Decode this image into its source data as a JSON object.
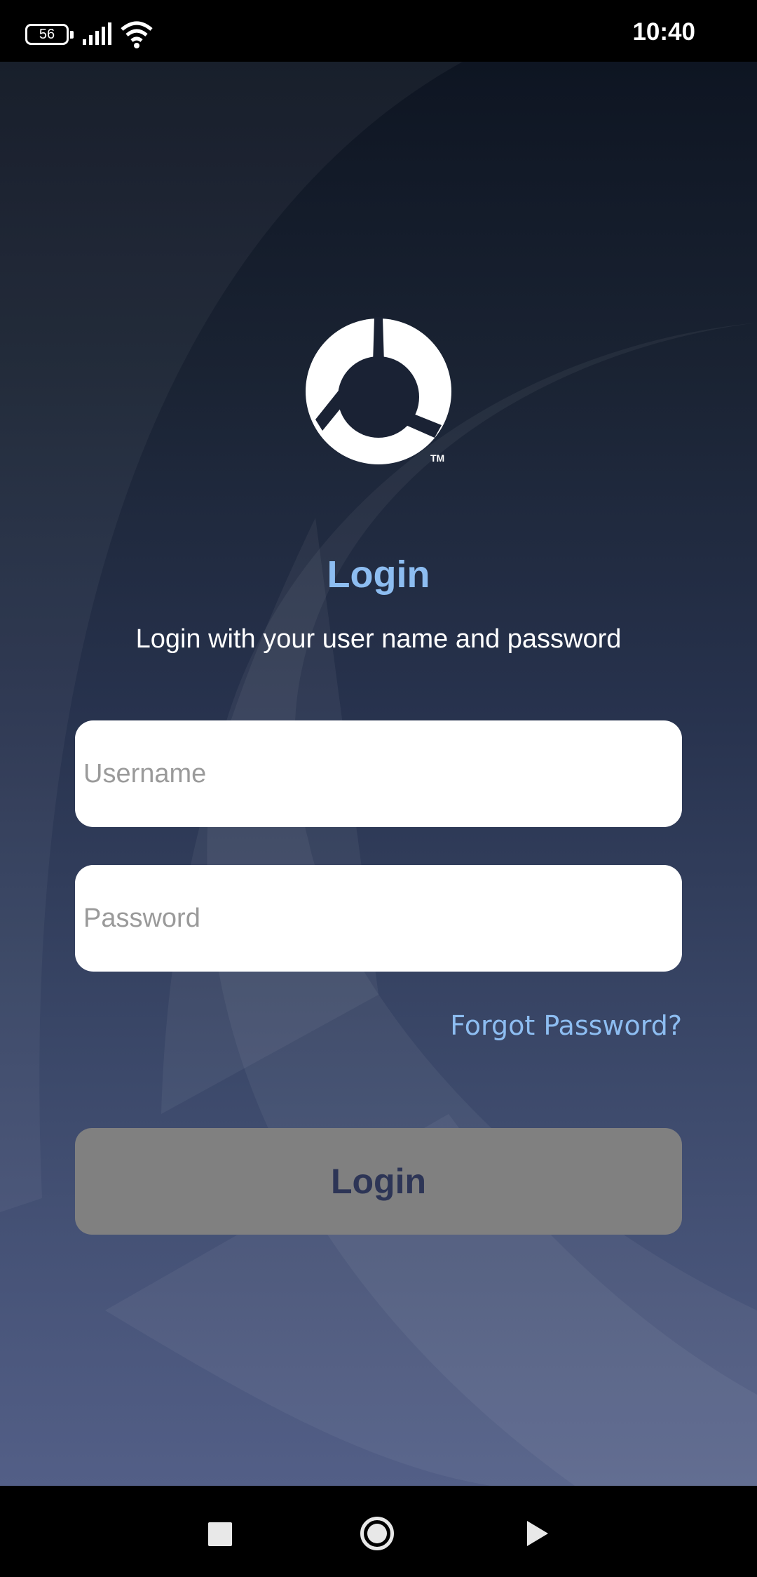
{
  "status_bar": {
    "battery_level": "56",
    "time": "10:40",
    "icons": [
      "battery-icon",
      "signal-icon",
      "wifi-icon"
    ]
  },
  "login": {
    "title": "Login",
    "subtitle": "Login with your user name and password",
    "username_placeholder": "Username",
    "password_placeholder": "Password",
    "forgot_password": "Forgot Password?",
    "button_label": "Login"
  },
  "logo": {
    "trademark": "TM"
  },
  "nav_bar": {
    "icons": [
      "recents-icon",
      "home-icon",
      "back-icon"
    ]
  },
  "colors": {
    "accent": "#8dbdf1",
    "button_disabled": "#808080",
    "button_text": "#2d3556"
  }
}
